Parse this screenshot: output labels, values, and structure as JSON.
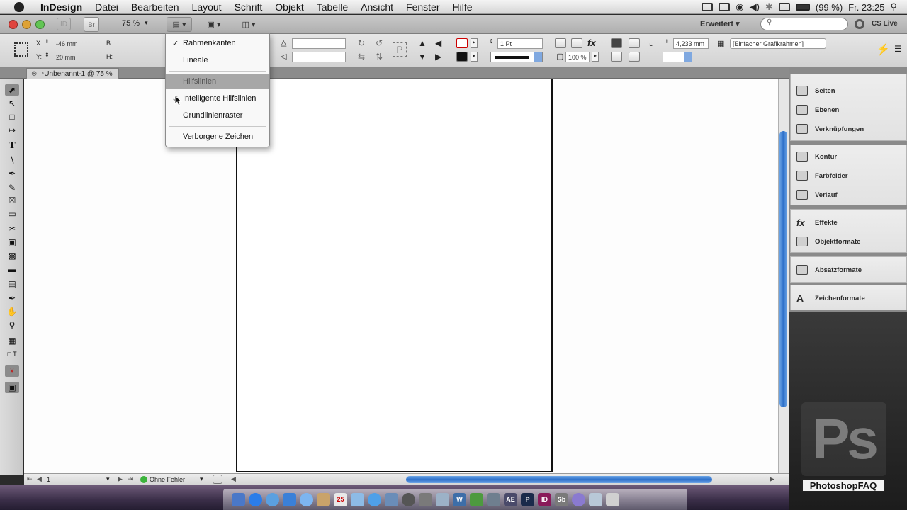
{
  "menubar": {
    "app_name": "InDesign",
    "items": [
      "Datei",
      "Bearbeiten",
      "Layout",
      "Schrift",
      "Objekt",
      "Tabelle",
      "Ansicht",
      "Fenster",
      "Hilfe"
    ],
    "battery": "(99 %)",
    "clock": "Fr. 23:25"
  },
  "appbar": {
    "zoom": "75 %",
    "workspace": "Erweitert ▾",
    "search_placeholder": "",
    "cs_live": "CS Live",
    "br_label": "Br"
  },
  "control": {
    "x_label": "X:",
    "x_value": "-46 mm",
    "y_label": "Y:",
    "y_value": "20 mm",
    "b_label": "B:",
    "h_label": "H:",
    "stroke_weight": "1 Pt",
    "opacity": "100 %",
    "offset": "4,233 mm",
    "object_style": "[Einfacher Grafikrahmen]"
  },
  "document": {
    "tab_title": "*Unbenannt-1 @ 75 %",
    "page_number": "1",
    "preflight": "Ohne Fehler"
  },
  "view_menu": {
    "items": [
      {
        "label": "Rahmenkanten",
        "checked": true
      },
      {
        "label": "Lineale",
        "checked": false
      },
      {
        "label": "Hilfslinien",
        "checked": false,
        "highlighted": true
      },
      {
        "label": "Intelligente Hilfslinien",
        "checked": true
      },
      {
        "label": "Grundlinienraster",
        "checked": false
      },
      {
        "label": "Verborgene Zeichen",
        "checked": false
      }
    ]
  },
  "panels": {
    "group1": [
      "Seiten",
      "Ebenen",
      "Verknüpfungen"
    ],
    "group2": [
      "Kontur",
      "Farbfelder",
      "Verlauf"
    ],
    "group3": [
      "Effekte",
      "Objektformate"
    ],
    "group4": [
      "Absatzformate"
    ],
    "group5": [
      "Zeichenformate"
    ]
  },
  "watermark": {
    "logo": "Ps",
    "brand": "PhotoshopFAQ"
  },
  "dock_labels": [
    "AE",
    "P",
    "ID",
    "Sb"
  ],
  "colors": {
    "accent_blue": "#2d6fc9",
    "close": "#e0443e",
    "minimize": "#dea236",
    "zoom": "#62c554"
  }
}
